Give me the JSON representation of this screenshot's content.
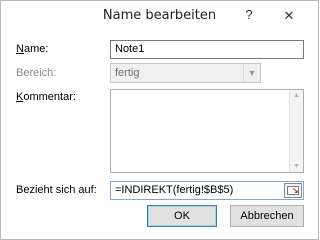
{
  "dialog": {
    "title": "Name bearbeiten",
    "help_glyph": "?",
    "close_glyph": "✕"
  },
  "form": {
    "name": {
      "label_hot": "N",
      "label_rest": "ame:",
      "value": "Note1"
    },
    "scope": {
      "label": "Bereich:",
      "value": "fertig",
      "enabled": false
    },
    "comment": {
      "label_hot": "K",
      "label_rest": "ommentar:",
      "value": ""
    },
    "refers_to": {
      "label": "Bezieht sich auf:",
      "value": "=INDIREKT(fertig!$B$5)"
    }
  },
  "buttons": {
    "ok": "OK",
    "cancel": "Abbrechen"
  }
}
